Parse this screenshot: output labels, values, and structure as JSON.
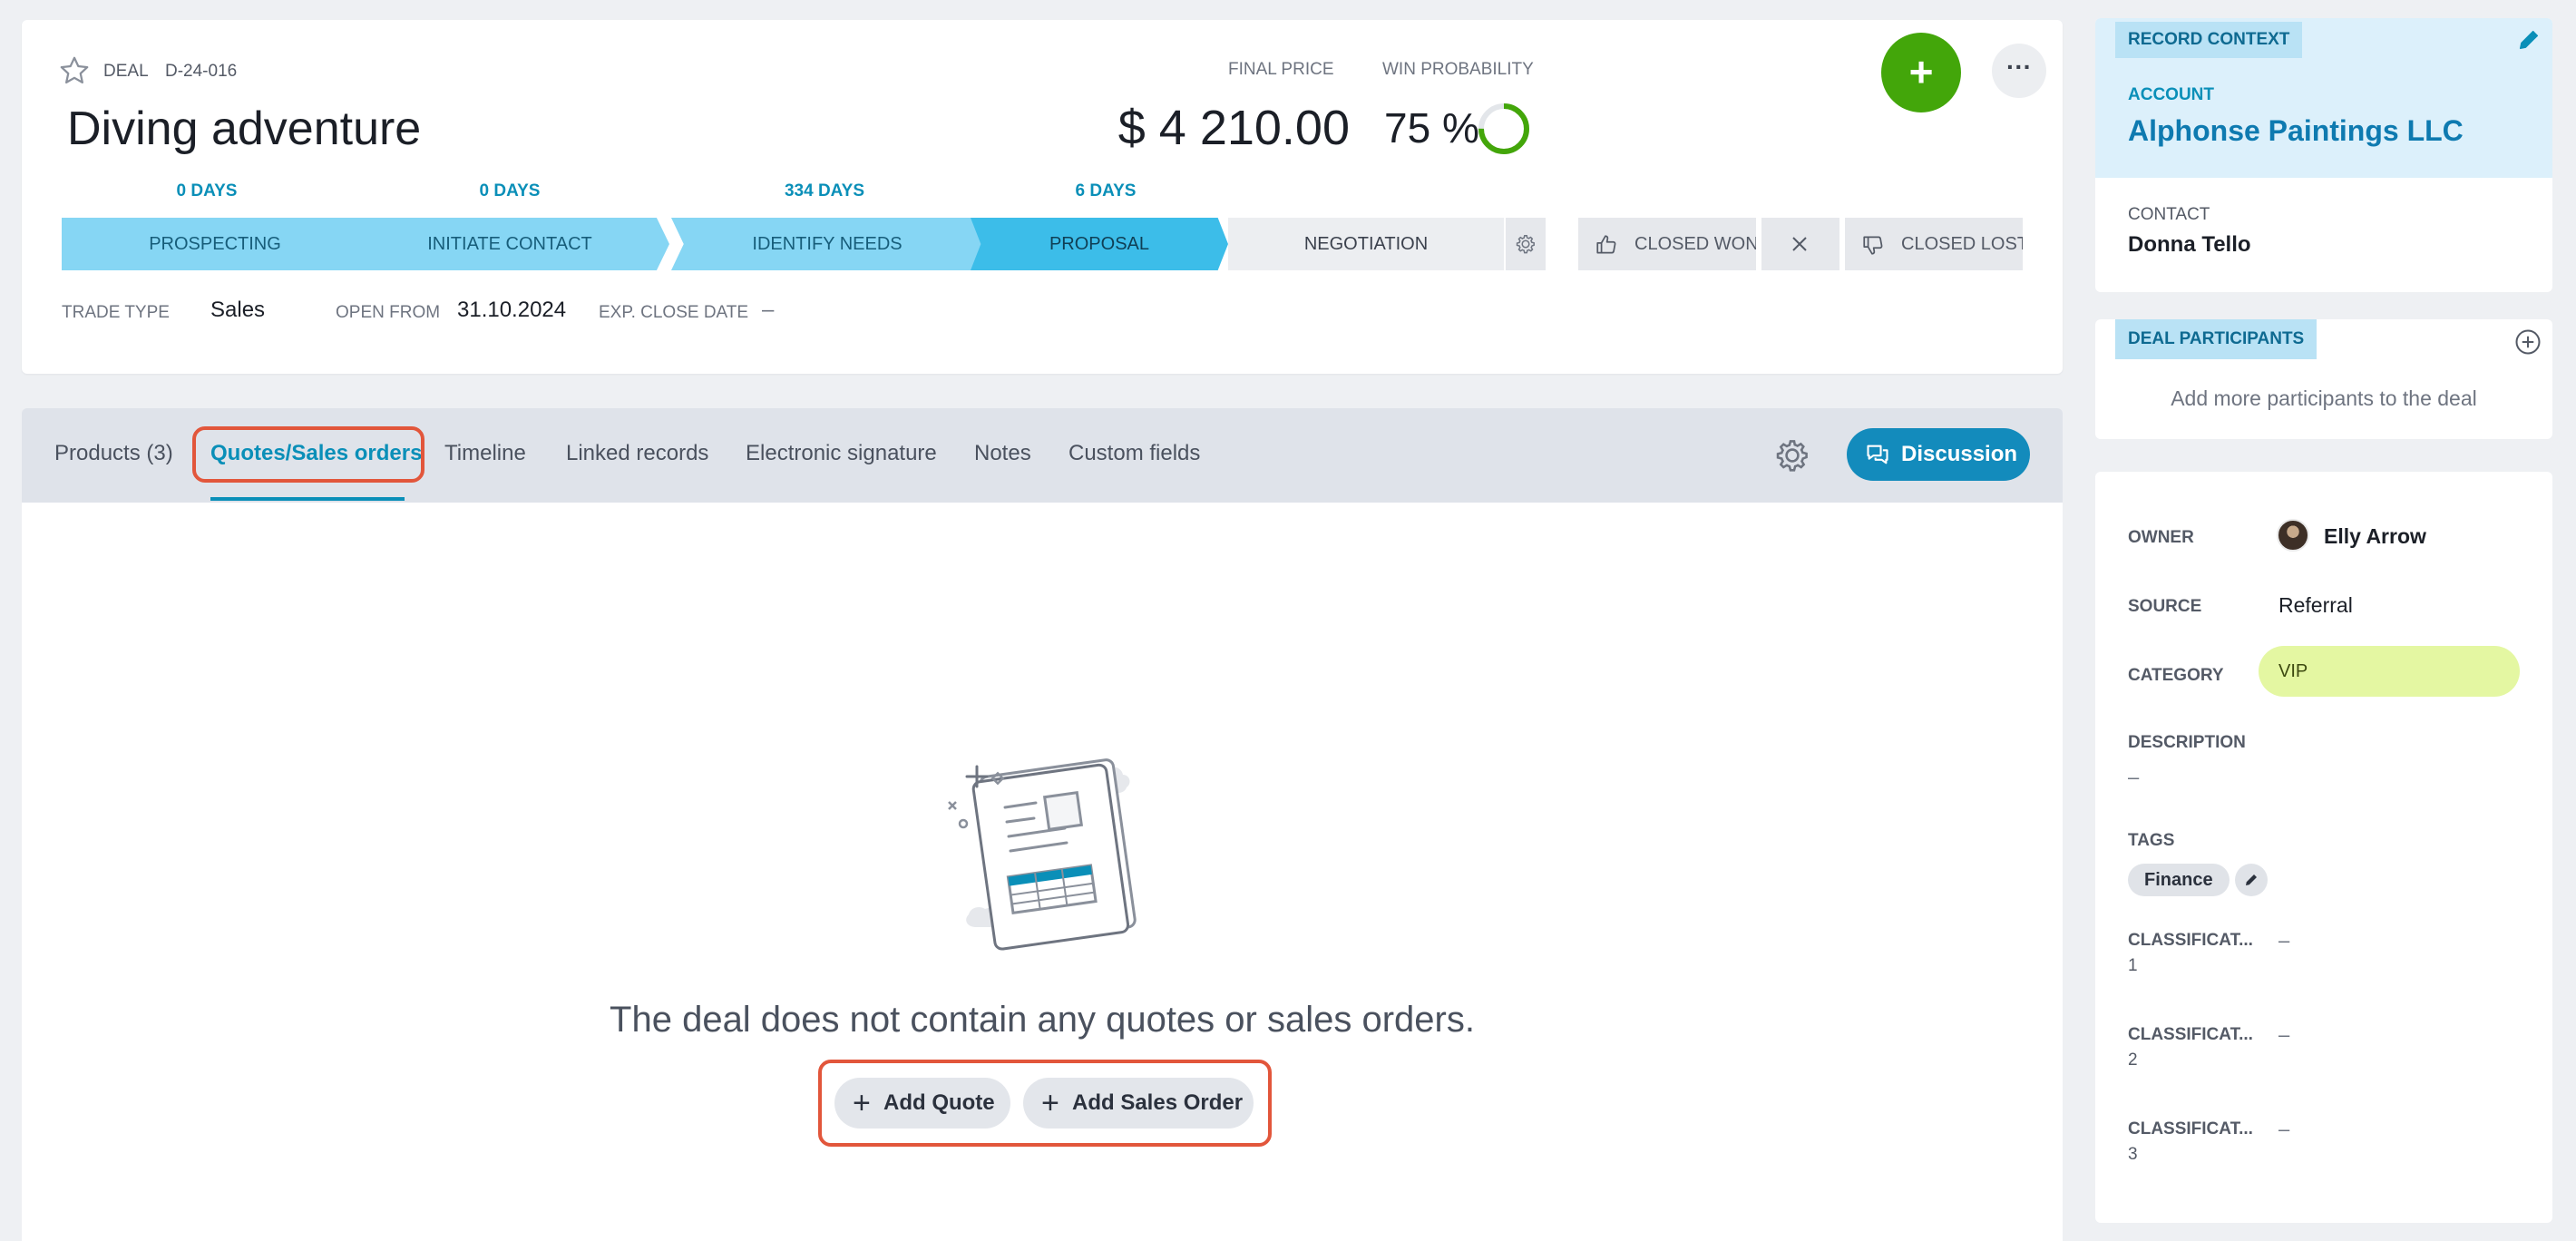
{
  "deal": {
    "kind": "Deal",
    "id": "D-24-016",
    "title": "Diving adventure",
    "final_price_label": "Final price",
    "final_price": "$ 4 210.00",
    "win_probability_label": "Win probability",
    "win_probability": "75 %",
    "win_probability_value": 0.75
  },
  "pipeline": {
    "days": [
      "0 days",
      "0 days",
      "334 days",
      "6 days"
    ],
    "stages": [
      "Prospecting",
      "Initiate contact",
      "Identify needs",
      "Proposal",
      "Negotiation"
    ],
    "current_stage": "Proposal",
    "closed_won": "Closed won",
    "closed_lost": "Closed lost"
  },
  "meta": {
    "trade_type_label": "Trade type",
    "trade_type": "Sales",
    "open_from_label": "Open from",
    "open_from": "31.10.2024",
    "exp_close_label": "Exp. close date",
    "exp_close": "–"
  },
  "tabs": {
    "items": [
      "Products (3)",
      "Quotes/Sales orders",
      "Timeline",
      "Linked records",
      "Electronic signature",
      "Notes",
      "Custom fields"
    ],
    "active": "Quotes/Sales orders",
    "discussion_label": "Discussion"
  },
  "empty_state": {
    "message": "The deal does not contain any quotes or sales orders.",
    "add_quote": "Add Quote",
    "add_sales_order": "Add Sales Order"
  },
  "record_context": {
    "badge": "Record context",
    "account_label": "Account",
    "account": "Alphonse Paintings LLC",
    "contact_label": "Contact",
    "contact": "Donna Tello"
  },
  "participants": {
    "badge": "Deal participants",
    "placeholder": "Add more participants to the deal"
  },
  "details": {
    "owner_label": "Owner",
    "owner": "Elly Arrow",
    "source_label": "Source",
    "source": "Referral",
    "category_label": "Category",
    "category": "VIP",
    "description_label": "Description",
    "description": "–",
    "tags_label": "Tags",
    "tags": [
      "Finance"
    ],
    "classifications": [
      {
        "label1": "Classificat...",
        "label2": "1",
        "value": "–"
      },
      {
        "label1": "Classificat...",
        "label2": "2",
        "value": "–"
      },
      {
        "label1": "Classificat...",
        "label2": "3",
        "value": "–"
      }
    ]
  },
  "colors": {
    "accent": "#0a8fb8",
    "add_button": "#43a60a",
    "stage_done": "#86d6f4",
    "stage_current": "#3cbde9",
    "highlight": "#e2563b",
    "vip": "#e4f7a2"
  }
}
